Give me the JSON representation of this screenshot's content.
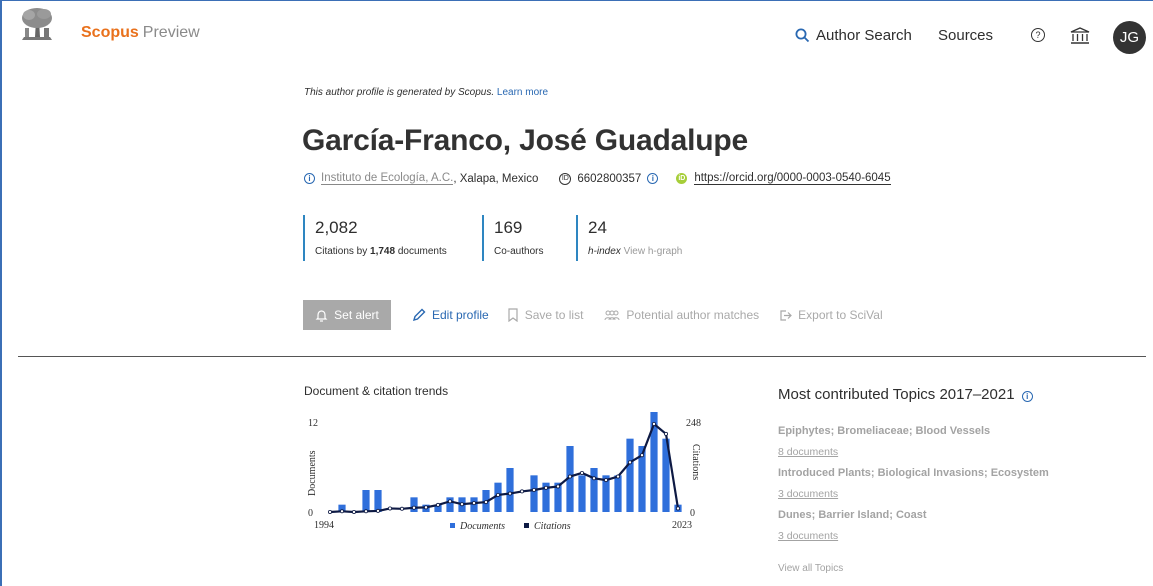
{
  "header": {
    "brand": "Scopus",
    "brand_sub": "Preview",
    "author_search": "Author Search",
    "sources": "Sources",
    "help_glyph": "?",
    "avatar_initials": "JG"
  },
  "profile": {
    "generated_note": "This author profile is generated by Scopus.",
    "learn_more": "Learn more",
    "name": "García-Franco, José Guadalupe",
    "affiliation": "Instituto de Ecología, A.C.",
    "location": ", Xalapa, Mexico",
    "author_id": "6602800357",
    "orcid": "https://orcid.org/0000-0003-0540-6045"
  },
  "metrics": {
    "citations": "2,082",
    "citations_label_pre": "Citations by ",
    "citations_docs": "1,748",
    "citations_label_post": " documents",
    "coauthors": "169",
    "coauthors_label": "Co-authors",
    "hindex": "24",
    "hindex_label": "h-index",
    "hgraph_label": "View h-graph"
  },
  "actions": {
    "set_alert": "Set alert",
    "edit_profile": "Edit profile",
    "save_to_list": "Save to list",
    "potential_matches": "Potential author matches",
    "export": "Export to SciVal"
  },
  "chart_section": {
    "title": "Document & citation trends"
  },
  "chart_data": {
    "type": "bar",
    "x_start_label": "1994",
    "x_end_label": "2023",
    "years": [
      1994,
      1995,
      1996,
      1997,
      1998,
      1999,
      2000,
      2001,
      2002,
      2003,
      2004,
      2005,
      2006,
      2007,
      2008,
      2009,
      2010,
      2011,
      2012,
      2013,
      2014,
      2015,
      2016,
      2017,
      2018,
      2019,
      2020,
      2021,
      2022,
      2023
    ],
    "series": [
      {
        "name": "Documents",
        "values": [
          0,
          1,
          0,
          3,
          3,
          0,
          0,
          2,
          1,
          1,
          2,
          2,
          2,
          3,
          4,
          6,
          0,
          5,
          4,
          4,
          9,
          5,
          6,
          5,
          5,
          10,
          9,
          14,
          10,
          1
        ],
        "axis": "left",
        "color": "#2f6fdb"
      },
      {
        "name": "Citations",
        "values": [
          0,
          2,
          0,
          2,
          3,
          10,
          9,
          12,
          13,
          20,
          30,
          22,
          25,
          28,
          48,
          52,
          58,
          62,
          68,
          72,
          100,
          110,
          95,
          90,
          100,
          140,
          160,
          248,
          220,
          10
        ],
        "axis": "right",
        "color": "#0e1a44"
      }
    ],
    "ylabel_left": "Documents",
    "ylabel_right": "Citations",
    "left_ymax": 12,
    "left_ymin": 0,
    "right_ymax": 248,
    "right_ymin": 0,
    "legend": "bottom"
  },
  "topics": {
    "title": "Most contributed Topics 2017–2021",
    "items": [
      {
        "name": "Epiphytes; Bromeliaceae; Blood Vessels",
        "docs": "8 documents"
      },
      {
        "name": "Introduced Plants; Biological Invasions; Ecosystem",
        "docs": "3 documents"
      },
      {
        "name": "Dunes; Barrier Island; Coast",
        "docs": "3 documents"
      }
    ],
    "view_all": "View all Topics"
  },
  "colors": {
    "accent": "#2968b2",
    "brand": "#e9711c",
    "bars": "#2f6fdb",
    "line": "#0e1a44"
  }
}
